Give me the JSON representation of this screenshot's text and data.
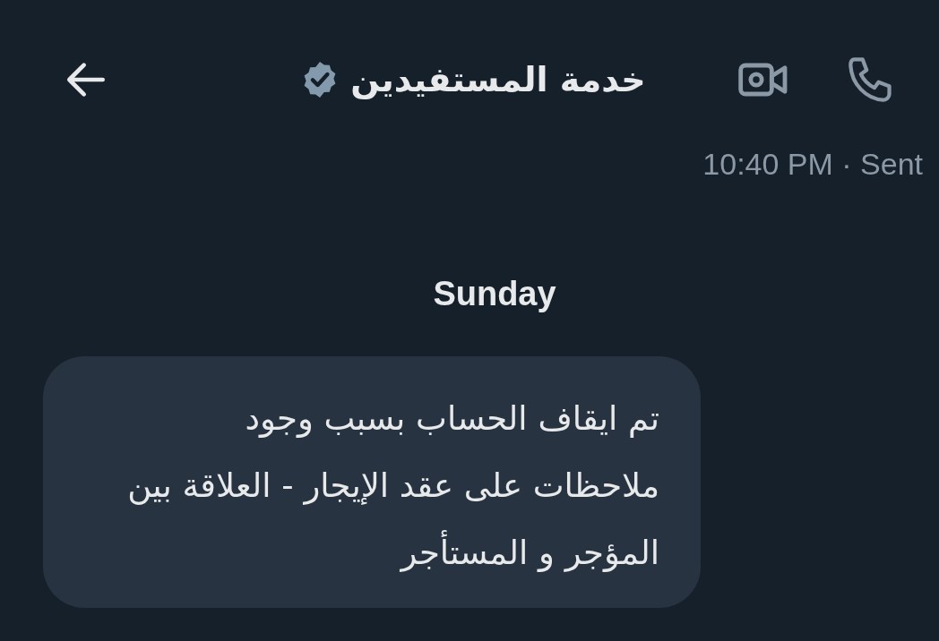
{
  "header": {
    "title": "خدمة المستفيدين",
    "verified": true
  },
  "status": "10:40 PM · Sent",
  "day_separator": "Sunday",
  "messages": [
    {
      "text": "تم ايقاف الحساب بسبب وجود ملاحظات على عقد الإيجار - العلاقة بين المؤجر و المستأجر",
      "outgoing": false
    }
  ]
}
